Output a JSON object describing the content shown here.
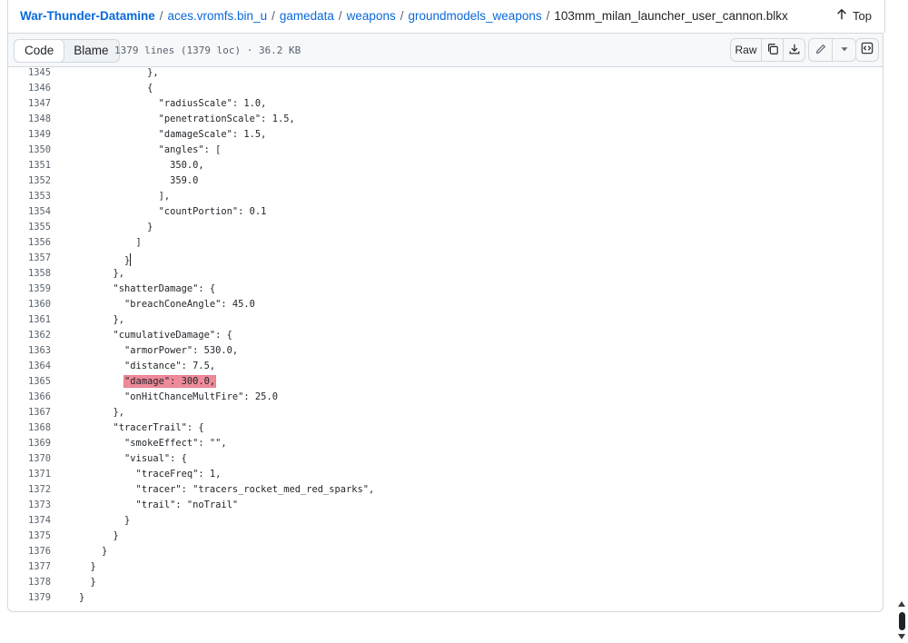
{
  "breadcrumb": {
    "items": [
      "War-Thunder-Datamine",
      "aces.vromfs.bin_u",
      "gamedata",
      "weapons",
      "groundmodels_weapons"
    ],
    "separator": "/",
    "current": "103mm_milan_launcher_user_cannon.blkx"
  },
  "top_button": {
    "label": "Top"
  },
  "toolbar": {
    "code_label": "Code",
    "blame_label": "Blame",
    "file_info": "1379 lines (1379 loc) · 36.2 KB",
    "raw_label": "Raw"
  },
  "icons": {
    "top": "arrow-up-icon",
    "copy": "copy-icon",
    "download": "download-icon",
    "edit": "pencil-icon",
    "more": "triangle-down-icon",
    "symbols": "code-square-icon"
  },
  "colors": {
    "link": "#0969da",
    "highlight": "#ee8a99"
  },
  "code_lines": [
    {
      "n": "1345",
      "text": "            },"
    },
    {
      "n": "1346",
      "text": "            {"
    },
    {
      "n": "1347",
      "text": "              \"radiusScale\": 1.0,"
    },
    {
      "n": "1348",
      "text": "              \"penetrationScale\": 1.5,"
    },
    {
      "n": "1349",
      "text": "              \"damageScale\": 1.5,"
    },
    {
      "n": "1350",
      "text": "              \"angles\": ["
    },
    {
      "n": "1351",
      "text": "                350.0,"
    },
    {
      "n": "1352",
      "text": "                359.0"
    },
    {
      "n": "1353",
      "text": "              ],"
    },
    {
      "n": "1354",
      "text": "              \"countPortion\": 0.1"
    },
    {
      "n": "1355",
      "text": "            }"
    },
    {
      "n": "1356",
      "text": "          ]"
    },
    {
      "n": "1357",
      "text": "        }"
    },
    {
      "n": "1358",
      "text": "      },"
    },
    {
      "n": "1359",
      "text": "      \"shatterDamage\": {"
    },
    {
      "n": "1360",
      "text": "        \"breachConeAngle\": 45.0"
    },
    {
      "n": "1361",
      "text": "      },"
    },
    {
      "n": "1362",
      "text": "      \"cumulativeDamage\": {"
    },
    {
      "n": "1363",
      "text": "        \"armorPower\": 530.0,"
    },
    {
      "n": "1364",
      "text": "        \"distance\": 7.5,"
    },
    {
      "n": "1365",
      "text": "        \"damage\": 300.0,"
    },
    {
      "n": "1366",
      "text": "        \"onHitChanceMultFire\": 25.0"
    },
    {
      "n": "1367",
      "text": "      },"
    },
    {
      "n": "1368",
      "text": "      \"tracerTrail\": {"
    },
    {
      "n": "1369",
      "text": "        \"smokeEffect\": \"\","
    },
    {
      "n": "1370",
      "text": "        \"visual\": {"
    },
    {
      "n": "1371",
      "text": "          \"traceFreq\": 1,"
    },
    {
      "n": "1372",
      "text": "          \"tracer\": \"tracers_rocket_med_red_sparks\","
    },
    {
      "n": "1373",
      "text": "          \"trail\": \"noTrail\""
    },
    {
      "n": "1374",
      "text": "        }"
    },
    {
      "n": "1375",
      "text": "      }"
    },
    {
      "n": "1376",
      "text": "    }"
    },
    {
      "n": "1377",
      "text": "  }"
    },
    {
      "n": "1378",
      "text": "  }"
    },
    {
      "n": "1379",
      "text": "}"
    }
  ]
}
